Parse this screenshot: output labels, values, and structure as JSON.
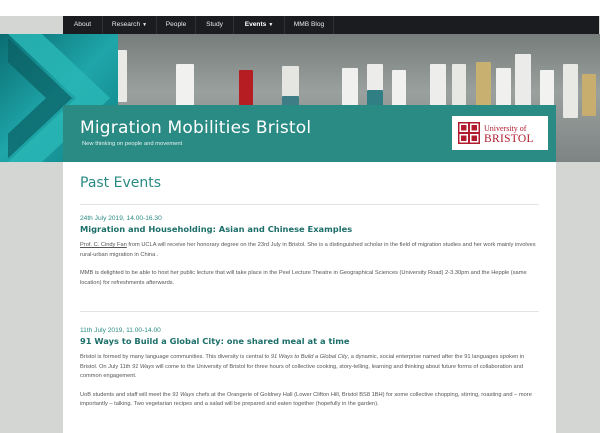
{
  "nav": {
    "items": [
      {
        "label": "About",
        "dropdown": false,
        "active": false
      },
      {
        "label": "Research",
        "dropdown": true,
        "active": false
      },
      {
        "label": "People",
        "dropdown": false,
        "active": false
      },
      {
        "label": "Study",
        "dropdown": false,
        "active": false
      },
      {
        "label": "Events",
        "dropdown": true,
        "active": true
      },
      {
        "label": "MMB Blog",
        "dropdown": false,
        "active": false
      }
    ],
    "chevron_glyph": "▼"
  },
  "header": {
    "title": "Migration Mobilities Bristol",
    "tagline": "New thinking on people and movement",
    "logo": {
      "line1": "University of",
      "line2": "BRISTOL",
      "icon": "university-crest-icon"
    }
  },
  "page": {
    "title": "Past Events"
  },
  "events": [
    {
      "date": "24th July 2019, 14.00-16.30",
      "title": "Migration and Householding: Asian and Chinese Examples",
      "paragraphs": [
        [
          {
            "text": "Prof. C. Cindy Fan",
            "link": true
          },
          {
            "text": " from UCLA will receive her honorary degree on the 23rd July in Bristol. She is a distinguished scholar in the field of migration studies and her work mainly involves rural-urban migration in China ."
          }
        ],
        [
          {
            "text": "MMB is delighted to be able to host her public lecture that will take place in the Peel Lecture Theatre in Geographical Sciences (University Road) 2-3.30pm and the Hepple (same location) for refreshments afterwards."
          }
        ]
      ]
    },
    {
      "date": "11th July 2019, 11.00-14.00",
      "title": "91 Ways to Build a Global City: one shared meal at a time",
      "paragraphs": [
        [
          {
            "text": "Bristol is formed by many language communities. This diversity is central to "
          },
          {
            "text": "91 Ways to Build a Global City",
            "em": true
          },
          {
            "text": ", a dynamic, social enterprise named after the 91 languages spoken in Bristol. On July 11th "
          },
          {
            "text": "91 Ways",
            "em": true
          },
          {
            "text": " will come to the University of Bristol for three hours of collective cooking, story-telling, learning and thinking about future forms of collaboration and common engagement."
          }
        ],
        [
          {
            "text": "UoB students and staff will meet the "
          },
          {
            "text": "91 Ways",
            "em": true
          },
          {
            "text": " chefs at the Orangerie of Goldney Hall (Lower Clifton Hill, Bristol BS8 1BH) for some collective chopping, stirring, roasting and – more importantly – talking. Two vegetarian recipes and a salad will be prepared and eaten together (hopefully in the garden)."
          }
        ]
      ]
    }
  ],
  "colors": {
    "brand_teal": "#2a8a84",
    "heading_teal": "#1d6f6a",
    "nav_bg": "#1b1c1f",
    "logo_red": "#b01c2e"
  }
}
